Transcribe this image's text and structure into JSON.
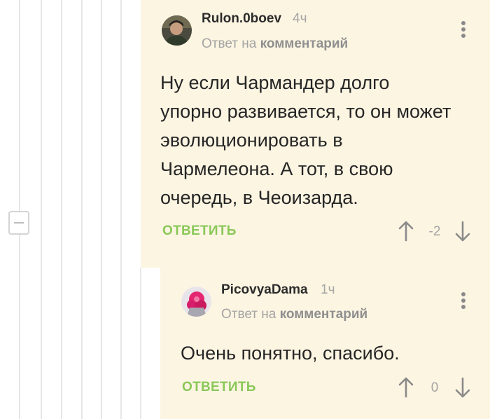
{
  "comments": [
    {
      "username": "Rulon.0boev",
      "time": "4ч",
      "reply_prefix": "Ответ на ",
      "reply_target": "комментарий",
      "text": "Ну если Чармандер долго упорно развивается, то он может эволюционировать в Чармелеона. А тот, в свою очередь, в Чеоизарда.",
      "reply_label": "ОТВЕТИТЬ",
      "score": "-2"
    },
    {
      "username": "PicovyaDama",
      "time": "1ч",
      "reply_prefix": "Ответ на ",
      "reply_target": "комментарий",
      "text": "Очень понятно, спасибо.",
      "reply_label": "ОТВЕТИТЬ",
      "score": "0"
    }
  ],
  "icons": {
    "collapse": "minus-icon",
    "more": "more-vertical-icon",
    "upvote": "arrow-up-icon",
    "downvote": "arrow-down-icon"
  },
  "colors": {
    "card_background": "#fcf5e2",
    "reply_button": "#8ac858",
    "text": "#262626",
    "muted": "#a3a3a3"
  }
}
